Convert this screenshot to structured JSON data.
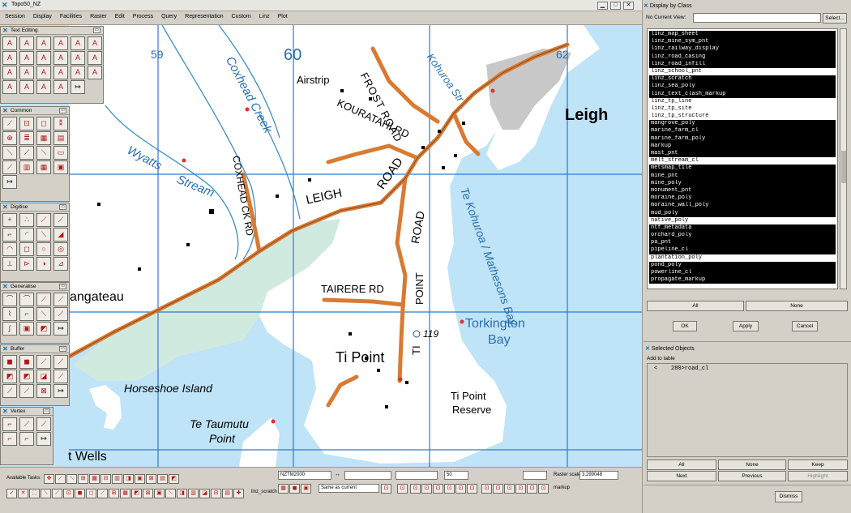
{
  "window": {
    "title": "Topo50_NZ"
  },
  "menu": [
    "Session",
    "Display",
    "Facilities",
    "Raster",
    "Edit",
    "Process",
    "Query",
    "Representation",
    "Custom",
    "Linz",
    "Plot"
  ],
  "palettes": {
    "text_editing": {
      "title": "Text Editing",
      "icons": [
        "A",
        "A",
        "A",
        "A",
        "A",
        "A",
        "A",
        "A",
        "A",
        "A",
        "A",
        "A",
        "A",
        "A",
        "A",
        "A",
        "A",
        "A",
        "A",
        "A",
        "A",
        "A",
        "↦"
      ]
    },
    "common": {
      "title": "Common",
      "icons": [
        "⟋",
        "⊡",
        "◻",
        "⁑",
        "⊕",
        "≣",
        "▦",
        "▤",
        "⟍",
        "⟋",
        "⟍",
        "▭",
        "⟋",
        "▥",
        "▦",
        "▣",
        "↦"
      ]
    },
    "digitise": {
      "title": "Digitise",
      "icons": [
        "+",
        "∴",
        "⟋",
        "⟋",
        "⌐",
        "◜",
        "⟍",
        "◢",
        "◠",
        "◻",
        "○",
        "◎",
        "⟂",
        "⊳",
        "◑",
        "⊿"
      ]
    },
    "generalise": {
      "title": "Generalise",
      "icons": [
        "⌒",
        "⌒",
        "⟋",
        "⟋",
        "⌇",
        "⌐",
        "⟍",
        "⟋",
        "∫",
        "▣",
        "◩",
        "↦"
      ]
    },
    "buffer": {
      "title": "Buffer",
      "icons": [
        "◼",
        "◼",
        "⟋",
        "⟋",
        "◩",
        "◩",
        "◪",
        "⟋",
        "⟋",
        "⟋",
        "⊠",
        "↦"
      ]
    },
    "vertex": {
      "title": "Vertex",
      "icons": [
        "⌐",
        "⟋",
        "⟋",
        "⌐",
        "⌐",
        "↦"
      ]
    }
  },
  "map": {
    "grid_numbers": [
      "59",
      "60",
      "62"
    ],
    "labels": {
      "airstrip": "Airstrip",
      "frost_road": "FROST ROAD",
      "kohuroa_str": "Kohuroa Str",
      "leigh": "Leigh",
      "coxhead_creek": "Coxhead Creek",
      "kouratahi": "KOURATAHI RD",
      "wyatts": "Wyatts",
      "stream": "Stream",
      "coxhead_rd": "COXHEAD CK RD",
      "leigh_road": "LEIGH",
      "road": "ROAD",
      "road2": "ROAD",
      "te_kohuroa": "Te Kohuroa / Mathesons Bay",
      "angateau": "angateau",
      "tairere": "TAIRERE RD",
      "point_road": "POINT",
      "ti": "TI",
      "torkington": "Torkington",
      "bay": "Bay",
      "spot": "119",
      "ti_point": "Ti Point",
      "horseshoe": "Horseshoe Island",
      "ti_point_reserve": "Ti Point",
      "reserve": "Reserve",
      "te_taumutu": "Te Taumutu",
      "point": "Point",
      "wells": "t Wells"
    }
  },
  "bottom": {
    "available_tasks": "Available Tasks:",
    "crs": "NZTM2000",
    "scale_value": "50",
    "raster_scale_label": "Raster scale",
    "raster_scale_value": "3.299048",
    "same_as_current": "Same as current",
    "markup": "markup",
    "linz_scratch": "linz_scratch"
  },
  "display_by_class": {
    "title": "Display by Class",
    "current_view_label": "No Current View:",
    "select_label": "Select...",
    "items": [
      {
        "name": "linz_map_sheet",
        "on": true
      },
      {
        "name": "linz_mine_sym_pnt",
        "on": true
      },
      {
        "name": "linz_railway_display",
        "on": true
      },
      {
        "name": "linz_road_casing",
        "on": true
      },
      {
        "name": "linz_road_infill",
        "on": true
      },
      {
        "name": "linz_school_pnt",
        "on": false
      },
      {
        "name": "linz_scratch",
        "on": true
      },
      {
        "name": "linz_sea_poly",
        "on": true
      },
      {
        "name": "linz_text_clash_markup",
        "on": true
      },
      {
        "name": "linz_tp_line",
        "on": false
      },
      {
        "name": "linz_tp_site",
        "on": false
      },
      {
        "name": "linz_tp_structure",
        "on": false
      },
      {
        "name": "mangrove_poly",
        "on": true
      },
      {
        "name": "marine_farm_cl",
        "on": true
      },
      {
        "name": "marine_farm_poly",
        "on": true
      },
      {
        "name": "markup",
        "on": true
      },
      {
        "name": "mast_pnt",
        "on": true
      },
      {
        "name": "melt_stream_cl",
        "on": false
      },
      {
        "name": "metsmap_tile",
        "on": true
      },
      {
        "name": "mine_pnt",
        "on": true
      },
      {
        "name": "mine_poly",
        "on": true
      },
      {
        "name": "monument_pnt",
        "on": true
      },
      {
        "name": "moraine_poly",
        "on": true
      },
      {
        "name": "moraine_wall_poly",
        "on": true
      },
      {
        "name": "mud_poly",
        "on": true
      },
      {
        "name": "native_poly",
        "on": false
      },
      {
        "name": "ntf_metadata",
        "on": true
      },
      {
        "name": "orchard_poly",
        "on": true
      },
      {
        "name": "pa_pnt",
        "on": true
      },
      {
        "name": "pipeline_cl",
        "on": true
      },
      {
        "name": "plantation_poly",
        "on": false
      },
      {
        "name": "pond_poly",
        "on": true
      },
      {
        "name": "powerline_cl",
        "on": true
      },
      {
        "name": "propagate_markup",
        "on": true
      }
    ],
    "all": "All",
    "none": "None",
    "ok": "OK",
    "apply": "Apply",
    "cancel": "Cancel"
  },
  "selected_objects": {
    "title": "Selected Objects",
    "add_to_table": "Add to table",
    "entry": "<    280>road_cl",
    "all": "All",
    "none": "None",
    "keep": "Keep",
    "next": "Next",
    "previous": "Previous",
    "highlight": "Highlight"
  },
  "dismiss": "Dismiss",
  "colors": {
    "sea": "#bfe3f7",
    "land": "#ffffff",
    "road": "#d97a32",
    "stream": "#3b8fc7",
    "grid": "#2a7bd0",
    "toolbar": "#d4d0c8",
    "selected": "#000000"
  }
}
